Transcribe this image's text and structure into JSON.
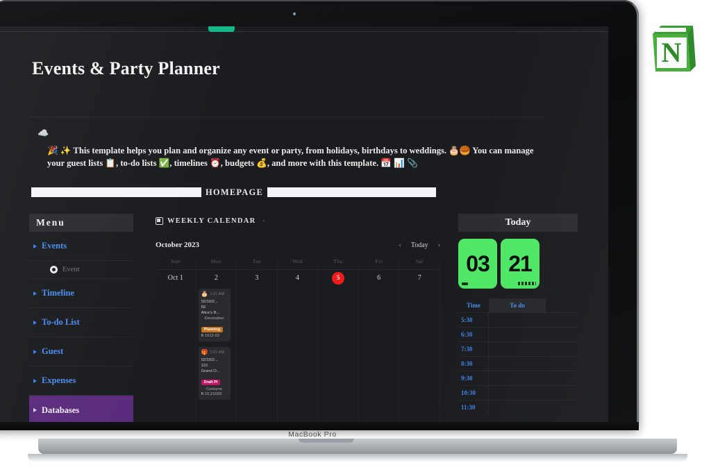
{
  "laptop": {
    "model_label": "MacBook Pro"
  },
  "brand": {
    "logo_name": "notion-logo",
    "logo_letter": "N",
    "logo_color": "#2f9e33"
  },
  "page": {
    "title": "Events & Party Planner",
    "callout_icon": "cloud-icon",
    "description": "🎉 ✨ This template helps you plan and organize any event or party, from holidays, birthdays to weddings. 🎂🥮 You can manage your guest lists 📋, to-do lists ✅, timelines ⏰, budgets 💰, and more with this template. 📅 📊 📎",
    "homepage_label": "HOMEPAGE"
  },
  "menu": {
    "header": "Menu",
    "items": [
      {
        "label": "Events",
        "active": false
      },
      {
        "label": "Timeline",
        "active": false
      },
      {
        "label": "To-do List",
        "active": false
      },
      {
        "label": "Guest",
        "active": false
      },
      {
        "label": "Expenses",
        "active": false
      },
      {
        "label": "Databases",
        "active": true
      }
    ],
    "sub_item": {
      "label": "Event",
      "icon": "circle-target-icon"
    },
    "active_color": "#5a2b7c",
    "link_color": "#4a8df0"
  },
  "calendar": {
    "section_title": "WEEKLY CALENDAR",
    "section_dash": "-",
    "month": "October 2023",
    "nav": {
      "prev": "‹",
      "today": "Today",
      "next": "›"
    },
    "day_headers": [
      "Sun",
      "Mon",
      "Tue",
      "Wed",
      "Thu",
      "Fri",
      "Sat"
    ],
    "day_numbers": [
      "Oct 1",
      "2",
      "3",
      "4",
      "5",
      "6",
      "7"
    ],
    "today_index": 4,
    "today_color": "#f01b1b",
    "events": [
      {
        "emoji": "🎂",
        "time": "1:21 AM",
        "line1": "02/10/2...",
        "line2": "50",
        "line3": "Alice's B...",
        "center": "Decoration",
        "badge": "Planning",
        "badge_color": "#c8731a",
        "footer": "B 1013 03"
      },
      {
        "emoji": "🎁",
        "time": "1:21 AM",
        "line1": "02/10/2...",
        "line2": "110",
        "line3": "Grand O...",
        "center": "Costume",
        "badge": "Draft Pl",
        "badge_color": "#c01463",
        "footer": "B 10,21003"
      }
    ]
  },
  "today_panel": {
    "header": "Today",
    "flip_left": "03",
    "flip_right": "21",
    "flip_color": "#4ee764",
    "table_headers": [
      "Time",
      "To do"
    ],
    "rows": [
      {
        "time": "5:30",
        "todo": ""
      },
      {
        "time": "6:30",
        "todo": ""
      },
      {
        "time": "7:30",
        "todo": ""
      },
      {
        "time": "8:30",
        "todo": ""
      },
      {
        "time": "9:30",
        "todo": ""
      },
      {
        "time": "10:30",
        "todo": ""
      },
      {
        "time": "11:30",
        "todo": ""
      }
    ]
  }
}
